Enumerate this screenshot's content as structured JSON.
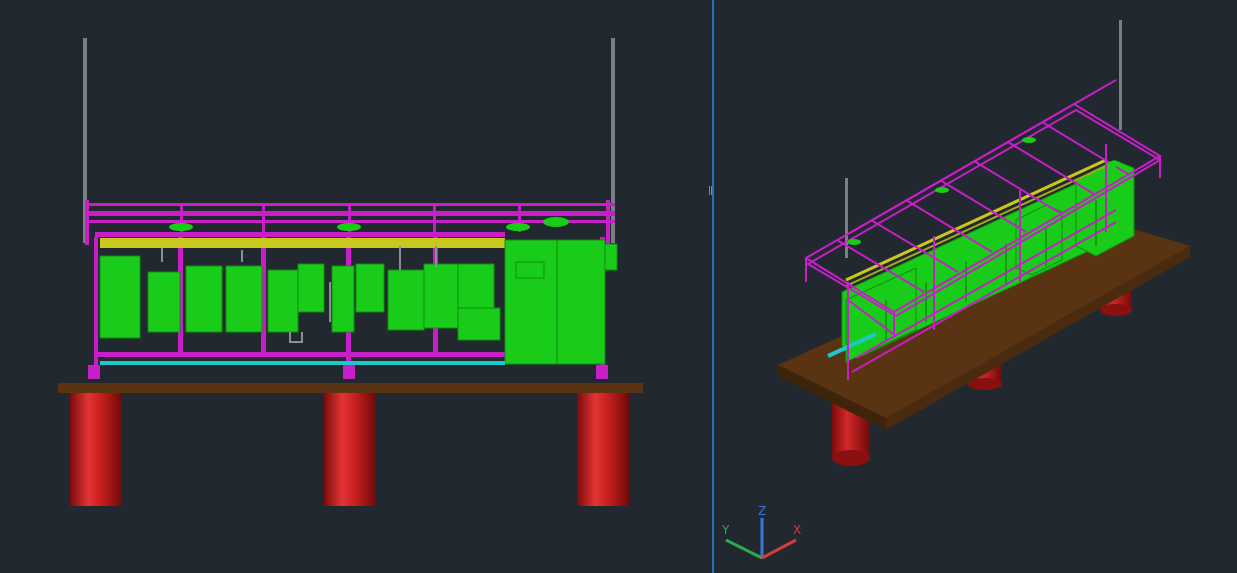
{
  "viewports": {
    "left": {
      "name": "front-elevation"
    },
    "right": {
      "name": "isometric-3d"
    }
  },
  "ucs_icon": {
    "x_label": "X",
    "y_label": "Y",
    "z_label": "Z",
    "colors": {
      "x": "#d33d3d",
      "y": "#2fa84f",
      "z": "#3b76d6"
    }
  },
  "colors": {
    "background": "#212830",
    "frame": "#c81ec8",
    "equipment": "#19cc19",
    "tray": "#c8c81e",
    "pipe": "#1ec8c8",
    "deck": "#5a3412",
    "piles": "#c41a1a",
    "masts": "#808080",
    "divider": "#2e6db4"
  }
}
